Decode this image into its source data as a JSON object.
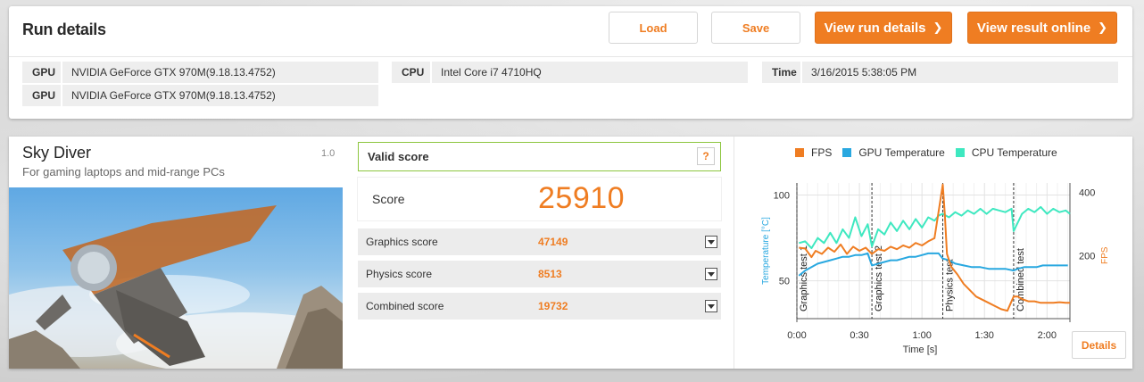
{
  "header": {
    "title": "Run details",
    "buttons": {
      "load": "Load",
      "save": "Save",
      "view_run_details": "View run details",
      "view_result_online": "View result online"
    }
  },
  "system_info": {
    "gpu1": {
      "label": "GPU",
      "value": "NVIDIA GeForce GTX 970M(9.18.13.4752)"
    },
    "gpu2": {
      "label": "GPU",
      "value": "NVIDIA GeForce GTX 970M(9.18.13.4752)"
    },
    "cpu": {
      "label": "CPU",
      "value": "Intel Core i7 4710HQ"
    },
    "time": {
      "label": "Time",
      "value": "3/16/2015 5:38:05 PM"
    }
  },
  "test": {
    "name": "Sky Diver",
    "subtitle": "For gaming laptops and mid-range PCs",
    "version": "1.0"
  },
  "result": {
    "status": "Valid score",
    "help_label": "?",
    "score_label": "Score",
    "score_value": "25910",
    "subscores": [
      {
        "label": "Graphics score",
        "value": "47149"
      },
      {
        "label": "Physics score",
        "value": "8513"
      },
      {
        "label": "Combined score",
        "value": "19732"
      }
    ]
  },
  "chart": {
    "legend": [
      "FPS",
      "GPU Temperature",
      "CPU Temperature"
    ],
    "colors": {
      "fps": "#ef7d22",
      "gpu": "#29a8e0",
      "cpu": "#3ee8c0",
      "accent": "#ef7d22",
      "valid": "#8dc63f"
    },
    "details_label": "Details"
  },
  "chart_data": {
    "type": "line",
    "xlabel": "Time [s]",
    "ylabel_left": "Temperature [°C]",
    "ylabel_right": "FPS",
    "x_ticks": [
      "0:00",
      "0:30",
      "1:00",
      "1:30",
      "2:00"
    ],
    "y_left_ticks": [
      50,
      100
    ],
    "y_right_ticks": [
      200,
      400
    ],
    "y_left_range": [
      28,
      107
    ],
    "y_right_range": [
      0,
      430
    ],
    "x_range": [
      0,
      131
    ],
    "sections": [
      {
        "label": "Graphics test 1",
        "start": 0
      },
      {
        "label": "Graphics test 2",
        "start": 36
      },
      {
        "label": "Physics test",
        "start": 70
      },
      {
        "label": "Combined test",
        "start": 104
      }
    ],
    "series": [
      {
        "name": "FPS",
        "axis": "right",
        "points": [
          [
            1,
            225
          ],
          [
            4,
            222
          ],
          [
            7,
            195
          ],
          [
            9,
            215
          ],
          [
            12,
            205
          ],
          [
            15,
            225
          ],
          [
            18,
            212
          ],
          [
            21,
            235
          ],
          [
            24,
            205
          ],
          [
            27,
            228
          ],
          [
            30,
            215
          ],
          [
            33,
            225
          ],
          [
            36,
            205
          ],
          [
            39,
            220
          ],
          [
            42,
            215
          ],
          [
            45,
            228
          ],
          [
            48,
            220
          ],
          [
            51,
            232
          ],
          [
            54,
            225
          ],
          [
            57,
            240
          ],
          [
            60,
            232
          ],
          [
            63,
            245
          ],
          [
            66,
            255
          ],
          [
            70,
            425
          ],
          [
            71,
            330
          ],
          [
            72,
            205
          ],
          [
            74,
            165
          ],
          [
            77,
            140
          ],
          [
            80,
            110
          ],
          [
            83,
            90
          ],
          [
            86,
            70
          ],
          [
            89,
            60
          ],
          [
            92,
            50
          ],
          [
            95,
            40
          ],
          [
            98,
            30
          ],
          [
            101,
            25
          ],
          [
            104,
            70
          ],
          [
            106,
            70
          ],
          [
            108,
            62
          ],
          [
            111,
            55
          ],
          [
            114,
            55
          ],
          [
            117,
            50
          ],
          [
            120,
            50
          ],
          [
            123,
            50
          ],
          [
            126,
            52
          ],
          [
            129,
            50
          ],
          [
            131,
            50
          ]
        ]
      },
      {
        "name": "GPU Temperature",
        "axis": "left",
        "points": [
          [
            1,
            53
          ],
          [
            4,
            56
          ],
          [
            7,
            58
          ],
          [
            10,
            60
          ],
          [
            13,
            61
          ],
          [
            16,
            62
          ],
          [
            19,
            63
          ],
          [
            22,
            64
          ],
          [
            25,
            64
          ],
          [
            28,
            65
          ],
          [
            31,
            65
          ],
          [
            34,
            66
          ],
          [
            36,
            59
          ],
          [
            39,
            60
          ],
          [
            42,
            61
          ],
          [
            45,
            62
          ],
          [
            48,
            62
          ],
          [
            51,
            63
          ],
          [
            54,
            64
          ],
          [
            57,
            64
          ],
          [
            60,
            65
          ],
          [
            63,
            66
          ],
          [
            66,
            66
          ],
          [
            68,
            66
          ],
          [
            70,
            63
          ],
          [
            73,
            62
          ],
          [
            76,
            60
          ],
          [
            80,
            59
          ],
          [
            84,
            58
          ],
          [
            88,
            58
          ],
          [
            92,
            57
          ],
          [
            96,
            57
          ],
          [
            100,
            57
          ],
          [
            104,
            56
          ],
          [
            106,
            57
          ],
          [
            109,
            58
          ],
          [
            112,
            58
          ],
          [
            115,
            58
          ],
          [
            118,
            59
          ],
          [
            121,
            59
          ],
          [
            124,
            59
          ],
          [
            127,
            59
          ],
          [
            130,
            59
          ]
        ]
      },
      {
        "name": "CPU Temperature",
        "axis": "left",
        "points": [
          [
            1,
            72
          ],
          [
            4,
            73
          ],
          [
            7,
            69
          ],
          [
            10,
            75
          ],
          [
            13,
            72
          ],
          [
            16,
            78
          ],
          [
            19,
            72
          ],
          [
            22,
            80
          ],
          [
            25,
            75
          ],
          [
            28,
            87
          ],
          [
            31,
            76
          ],
          [
            34,
            83
          ],
          [
            36,
            70
          ],
          [
            39,
            80
          ],
          [
            42,
            77
          ],
          [
            45,
            84
          ],
          [
            48,
            79
          ],
          [
            51,
            85
          ],
          [
            54,
            80
          ],
          [
            57,
            86
          ],
          [
            60,
            81
          ],
          [
            63,
            87
          ],
          [
            66,
            85
          ],
          [
            68,
            88
          ],
          [
            70,
            89
          ],
          [
            73,
            87
          ],
          [
            76,
            90
          ],
          [
            79,
            88
          ],
          [
            82,
            91
          ],
          [
            85,
            89
          ],
          [
            88,
            92
          ],
          [
            91,
            89
          ],
          [
            94,
            92
          ],
          [
            97,
            91
          ],
          [
            100,
            90
          ],
          [
            103,
            92
          ],
          [
            104,
            79
          ],
          [
            106,
            84
          ],
          [
            108,
            89
          ],
          [
            111,
            92
          ],
          [
            114,
            90
          ],
          [
            117,
            93
          ],
          [
            120,
            89
          ],
          [
            123,
            92
          ],
          [
            126,
            90
          ],
          [
            129,
            91
          ],
          [
            131,
            89
          ]
        ]
      }
    ]
  }
}
